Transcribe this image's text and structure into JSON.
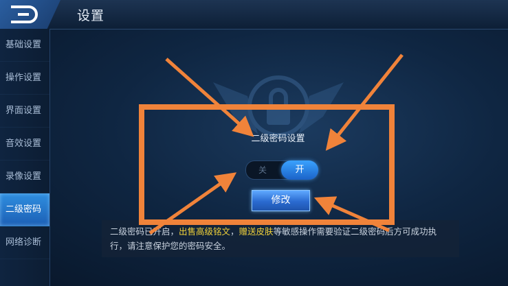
{
  "header": {
    "title": "设置",
    "back_icon": "back-arrow-icon"
  },
  "sidebar": {
    "items": [
      {
        "label": "基础设置",
        "active": false
      },
      {
        "label": "操作设置",
        "active": false
      },
      {
        "label": "界面设置",
        "active": false
      },
      {
        "label": "音效设置",
        "active": false
      },
      {
        "label": "录像设置",
        "active": false
      },
      {
        "label": "二级密码",
        "active": true
      },
      {
        "label": "网络诊断",
        "active": false
      }
    ]
  },
  "panel": {
    "title": "二级密码设置",
    "toggle": {
      "off_label": "关",
      "on_label": "开",
      "state": "on"
    },
    "modify_label": "修改"
  },
  "notice": {
    "part1": "二级密码已开启，",
    "highlight1": "出售高级铭文",
    "sep": "，",
    "highlight2": "赠送皮肤",
    "part2": "等敏感操作需要验证二级密码后方可成功执行，请注意保护您的密码安全。"
  },
  "colors": {
    "annotation": "#f0833a",
    "active_tab": "#2f8fe0",
    "highlight_text": "#f1d23a"
  }
}
